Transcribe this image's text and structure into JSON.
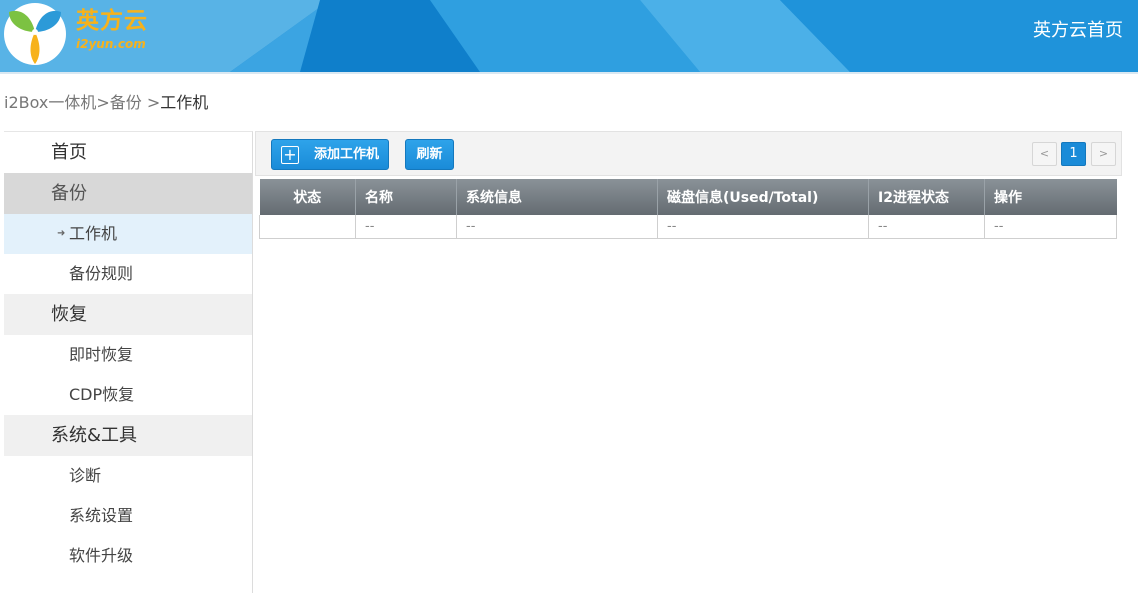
{
  "header": {
    "brand_cn": "英方云",
    "brand_en": "i2yun.com",
    "home_link": "英方云首页"
  },
  "breadcrumb": {
    "part1": "i2Box一体机>备份 >",
    "current": "工作机"
  },
  "sidebar": {
    "items": [
      {
        "label": "首页"
      },
      {
        "label": "备份"
      },
      {
        "label": "工作机"
      },
      {
        "label": "备份规则"
      },
      {
        "label": "恢复"
      },
      {
        "label": "即时恢复"
      },
      {
        "label": "CDP恢复"
      },
      {
        "label": "系统&工具"
      },
      {
        "label": "诊断"
      },
      {
        "label": "系统设置"
      },
      {
        "label": "软件升级"
      }
    ]
  },
  "toolbar": {
    "add_label": "添加工作机",
    "refresh_label": "刷新"
  },
  "pager": {
    "prev": "<",
    "current": "1",
    "next": ">"
  },
  "table": {
    "headers": [
      "状态",
      "名称",
      "系统信息",
      "磁盘信息(Used/Total)",
      "I2进程状态",
      "操作"
    ],
    "rows": [
      [
        "",
        "--",
        "--",
        "--",
        "--",
        "--"
      ]
    ]
  },
  "colors": {
    "header_bg": "#1c8fd6",
    "brand_text": "#f7b21b",
    "button_blue": "#1a8bd8",
    "sidebar_active": "#d8d8d8",
    "sidebar_selected": "#e3f1fb"
  }
}
